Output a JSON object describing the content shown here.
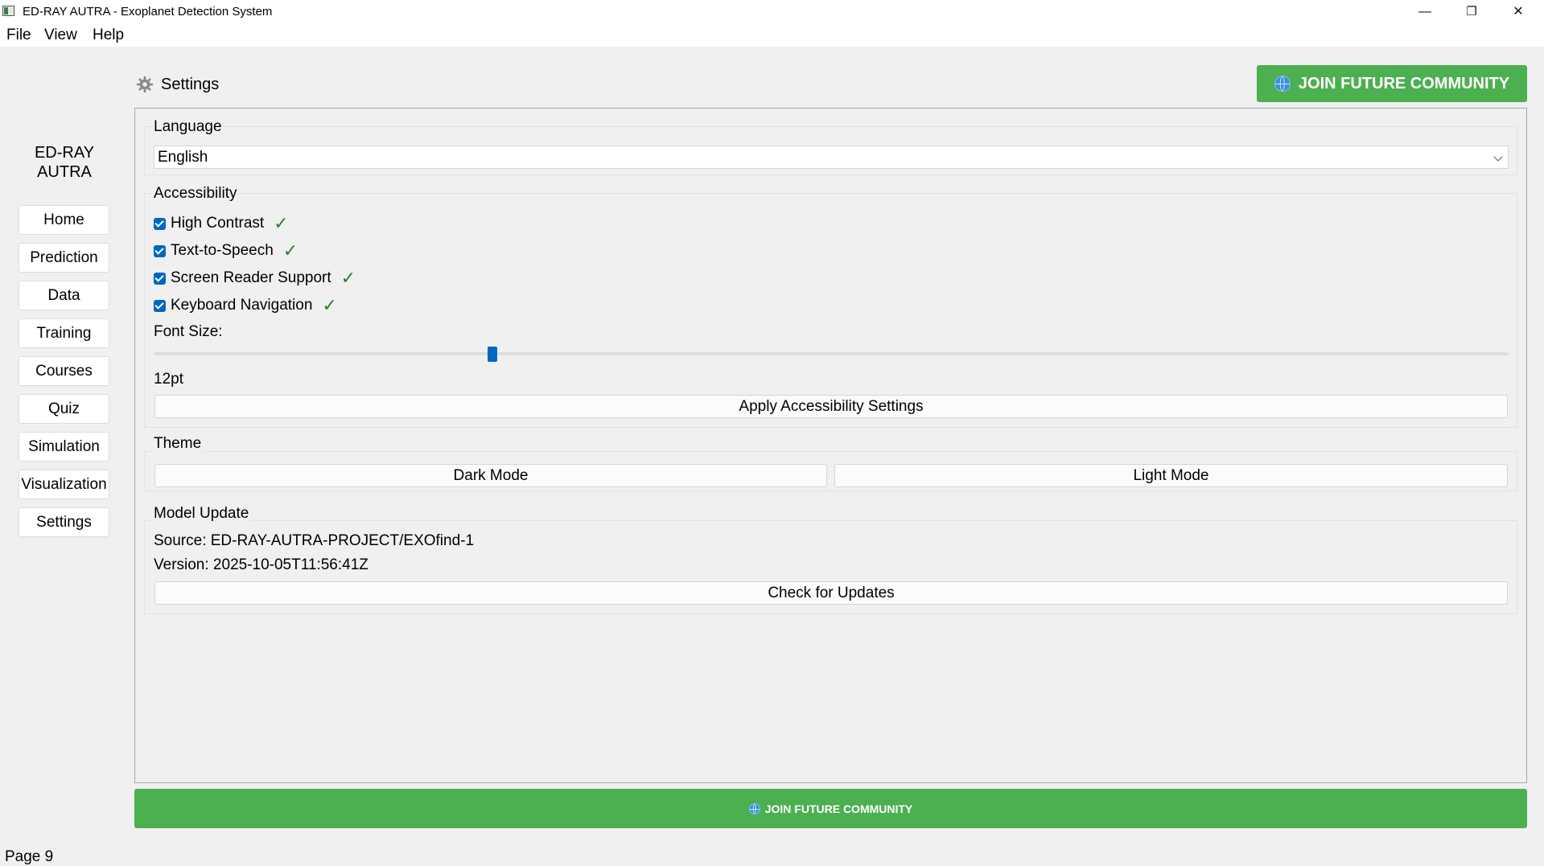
{
  "window": {
    "title": "ED-RAY AUTRA - Exoplanet Detection System",
    "minimize": "—",
    "restore": "❐",
    "close": "✕"
  },
  "menu": {
    "items": [
      "File",
      "View",
      "Help"
    ]
  },
  "sidebar": {
    "brand_line1": "ED-RAY",
    "brand_line2": "AUTRA",
    "items": [
      "Home",
      "Prediction",
      "Data",
      "Training",
      "Courses",
      "Quiz",
      "Simulation",
      "Visualization",
      "Settings"
    ]
  },
  "header": {
    "icon": "gear-icon",
    "title": "Settings",
    "join_button": "JOIN FUTURE COMMUNITY"
  },
  "language": {
    "title": "Language",
    "selected": "English"
  },
  "accessibility": {
    "title": "Accessibility",
    "options": [
      {
        "label": "High Contrast",
        "checked": true,
        "status": "✓"
      },
      {
        "label": "Text-to-Speech",
        "checked": true,
        "status": "✓"
      },
      {
        "label": "Screen Reader Support",
        "checked": true,
        "status": "✓"
      },
      {
        "label": "Keyboard Navigation",
        "checked": true,
        "status": "✓"
      }
    ],
    "font_size_label": "Font Size:",
    "font_size_value": "12pt",
    "font_size_slider_fraction": 0.25,
    "apply_button": "Apply Accessibility Settings"
  },
  "theme": {
    "title": "Theme",
    "dark_button": "Dark Mode",
    "light_button": "Light Mode"
  },
  "model_update": {
    "title": "Model Update",
    "source": "Source: ED-RAY-AUTRA-PROJECT/EXOfind-1",
    "version": "Version: 2025-10-05T11:56:41Z",
    "check_button": "Check for Updates"
  },
  "footer": {
    "join_button": "JOIN FUTURE COMMUNITY",
    "page_label": "Page 9"
  },
  "colors": {
    "accent_green": "#4caf50",
    "checkbox_blue": "#0067c0",
    "tick_green": "#2e7d32"
  }
}
